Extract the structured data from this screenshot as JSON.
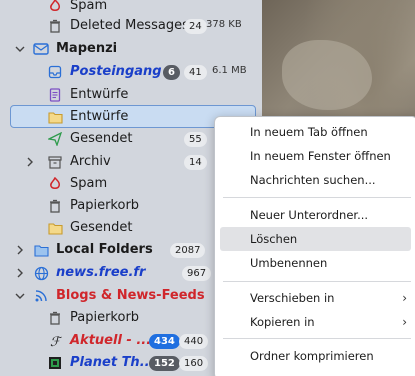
{
  "folders": [
    {
      "label": "Spam",
      "style": "red",
      "icon": "spam-icon"
    },
    {
      "label": "Deleted Messages",
      "unread": "",
      "total": "24",
      "size": "378 KB",
      "icon": "trash-icon"
    },
    {
      "label": "Mapenzi",
      "style": "bold",
      "icon": "account-icon"
    },
    {
      "label": "Posteingang",
      "unread": "6",
      "total": "41",
      "size": "6.1 MB",
      "icon": "inbox-icon"
    },
    {
      "label": "Entwürfe",
      "icon": "drafts-icon"
    },
    {
      "label": "Entwürfe",
      "icon": "folder-icon"
    },
    {
      "label": "Gesendet",
      "total": "55",
      "icon": "sent-icon"
    },
    {
      "label": "Archiv",
      "total": "14",
      "icon": "archive-icon"
    },
    {
      "label": "Spam",
      "icon": "spam-icon"
    },
    {
      "label": "Papierkorb",
      "icon": "trash-icon"
    },
    {
      "label": "Gesendet",
      "icon": "folder-icon"
    },
    {
      "label": "Local Folders",
      "total": "2087",
      "icon": "folder-icon"
    },
    {
      "label": "news.free.fr",
      "total": "967",
      "icon": "globe-icon"
    },
    {
      "label": "Blogs & News-Feeds",
      "icon": "rss-icon"
    },
    {
      "label": "Papierkorb",
      "icon": "trash-icon"
    },
    {
      "label": "Aktuell - ...",
      "unread": "434",
      "total": "440",
      "icon": "feed-icon"
    },
    {
      "label": "Planet Th...",
      "unread": "152",
      "total": "160",
      "icon": "planet-icon"
    }
  ],
  "context_menu": [
    "In neuem Tab öffnen",
    "In neuem Fenster öffnen",
    "Nachrichten suchen...",
    "Neuer Unterordner...",
    "Löschen",
    "Umbenennen",
    "Verschieben in",
    "Kopieren in",
    "Ordner komprimieren"
  ],
  "colors": {
    "unread_blue": "#1a3fc9",
    "feed_red": "#d0262b",
    "selection": "#c9dcf2",
    "badge_blue": "#1f6fe0"
  }
}
